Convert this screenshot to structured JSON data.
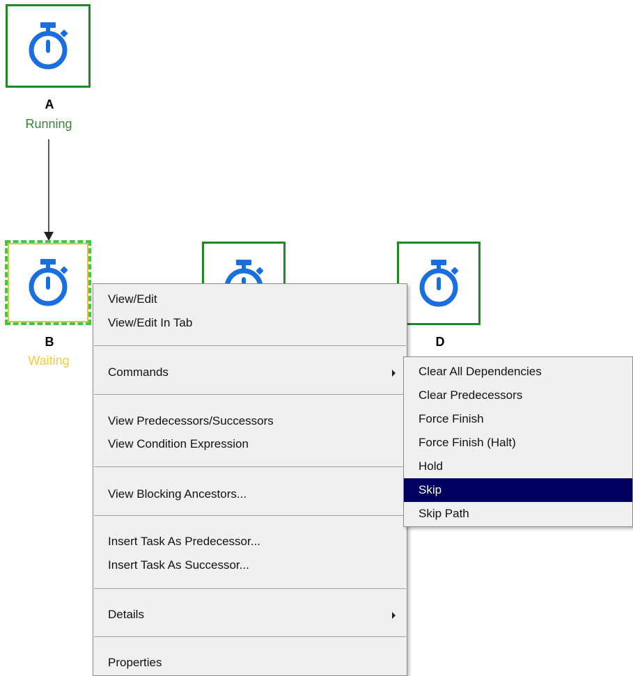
{
  "nodes": [
    {
      "id": "A",
      "name": "A",
      "status": "Running"
    },
    {
      "id": "B",
      "name": "B",
      "status": "Waiting"
    },
    {
      "id": "C",
      "name": "",
      "status": ""
    },
    {
      "id": "D",
      "name": "D",
      "status": ""
    }
  ],
  "context_menu": {
    "items": [
      {
        "label": "View/Edit"
      },
      {
        "label": "View/Edit In Tab"
      },
      {
        "label": "Commands",
        "submenu": true
      },
      {
        "label": "View Predecessors/Successors"
      },
      {
        "label": "View Condition Expression"
      },
      {
        "label": "View Blocking Ancestors..."
      },
      {
        "label": "Insert Task As Predecessor..."
      },
      {
        "label": "Insert Task As Successor..."
      },
      {
        "label": "Details",
        "submenu": true
      },
      {
        "label": "Properties"
      }
    ]
  },
  "commands_submenu": {
    "items": [
      {
        "label": "Clear All Dependencies"
      },
      {
        "label": "Clear Predecessors"
      },
      {
        "label": "Force Finish"
      },
      {
        "label": "Force Finish (Halt)"
      },
      {
        "label": "Hold"
      },
      {
        "label": "Skip",
        "highlighted": true
      },
      {
        "label": "Skip Path"
      }
    ]
  },
  "colors": {
    "running": "#2e8b2e",
    "waiting": "#f2cd37",
    "node_border": "#1f8b1f",
    "icon_blue": "#1a6fe0",
    "highlight": "#000060"
  },
  "icons": {
    "task": "stopwatch-icon",
    "submenu": "chevron-right-icon"
  }
}
